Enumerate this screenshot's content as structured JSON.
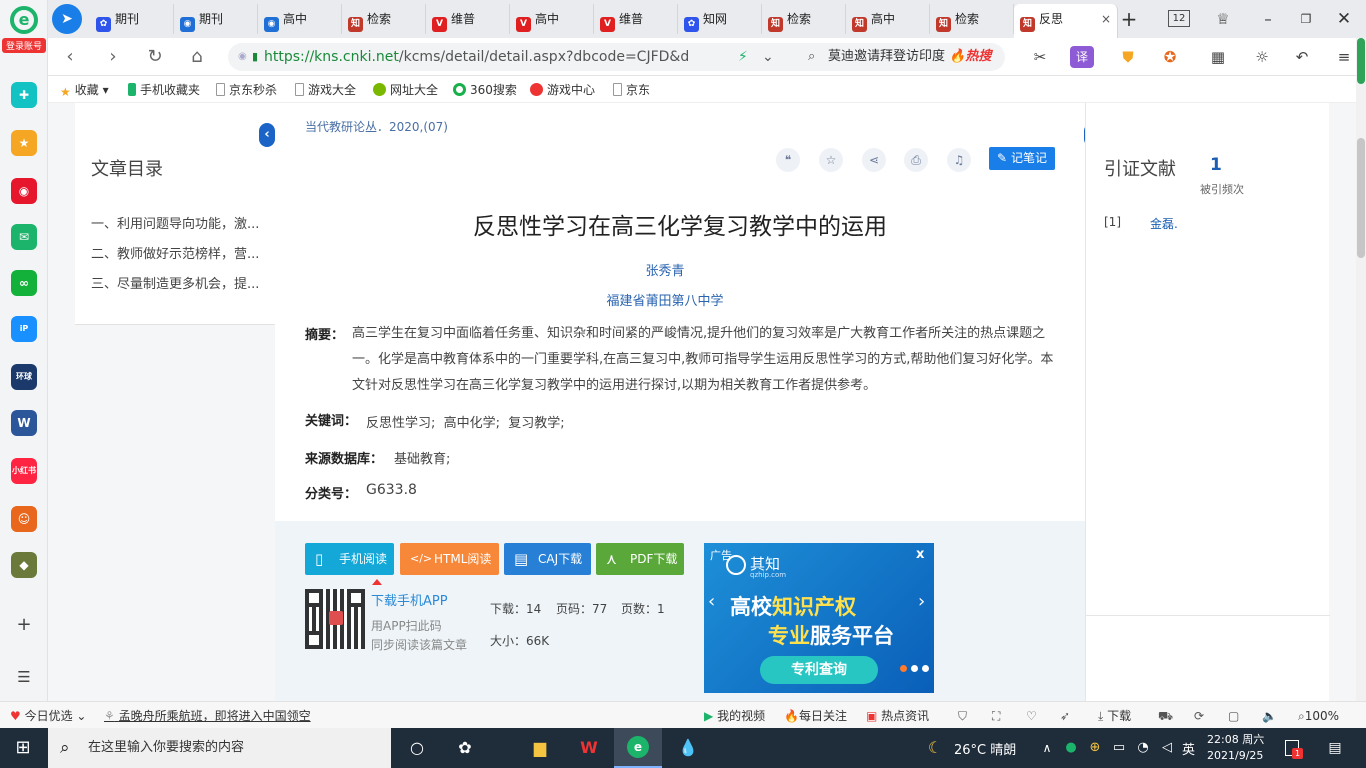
{
  "sidebar": {
    "login_label": "登录账号",
    "icons": [
      {
        "name": "plus-cross-app-icon",
        "glyph": "✚",
        "color": "#13c2c2"
      },
      {
        "name": "favorites-star-icon",
        "glyph": "★",
        "color": "#f5a623"
      },
      {
        "name": "weibo-icon",
        "glyph": "◉",
        "color": "#e6162d"
      },
      {
        "name": "mail-icon",
        "glyph": "✉",
        "color": "#1bb46a"
      },
      {
        "name": "link-app-icon",
        "glyph": "∞",
        "color": "#13b03a"
      },
      {
        "name": "ip-app-icon",
        "glyph": "iP",
        "color": "#1890ff"
      },
      {
        "name": "global-web-icon",
        "glyph": "环球",
        "color": "#1b3a6b"
      },
      {
        "name": "word-document-icon",
        "glyph": "W",
        "color": "#2b579a"
      },
      {
        "name": "xiaohongshu-icon",
        "glyph": "小红书",
        "color": "#ff2442"
      },
      {
        "name": "game-character-icon",
        "glyph": "☺",
        "color": "#e8671c"
      },
      {
        "name": "pubg-game-icon",
        "glyph": "◆",
        "color": "#6b7a3a"
      }
    ],
    "add_glyph": "+",
    "menu_glyph": "☰"
  },
  "tabs": [
    {
      "label": "期刊",
      "icon": "baidu-paw-icon",
      "glyph": "✿",
      "color": "#2f54eb"
    },
    {
      "label": "期刊",
      "icon": "chrome-circle-icon",
      "glyph": "◉",
      "color": "#1f6fd6"
    },
    {
      "label": "高中",
      "icon": "chrome-circle-icon",
      "glyph": "◉",
      "color": "#1f6fd6"
    },
    {
      "label": "检索",
      "icon": "cnki-zhi-icon",
      "glyph": "知",
      "color": "#c0392b"
    },
    {
      "label": "维普",
      "icon": "weipu-icon",
      "glyph": "V",
      "color": "#e02020"
    },
    {
      "label": "高中",
      "icon": "weipu-icon",
      "glyph": "V",
      "color": "#e02020"
    },
    {
      "label": "维普",
      "icon": "weipu-icon",
      "glyph": "V",
      "color": "#e02020"
    },
    {
      "label": "知网",
      "icon": "baidu-paw-icon",
      "glyph": "✿",
      "color": "#2f54eb"
    },
    {
      "label": "检索",
      "icon": "cnki-zhi-icon",
      "glyph": "知",
      "color": "#c0392b"
    },
    {
      "label": "高中",
      "icon": "cnki-zhi-icon",
      "glyph": "知",
      "color": "#c0392b"
    },
    {
      "label": "检索",
      "icon": "cnki-zhi-icon",
      "glyph": "知",
      "color": "#c0392b"
    },
    {
      "label": "反思",
      "icon": "cnki-zhi-icon",
      "glyph": "知",
      "color": "#c0392b",
      "active": true
    }
  ],
  "tabbar": {
    "new_tab": "+",
    "tab_count": "12",
    "close": "×"
  },
  "address": {
    "url_host": "https://kns.cnki.net",
    "url_path": "/kcms/detail/detail.aspx?dbcode=CJFD&d",
    "search_text": "莫迪邀请拜登访印度",
    "search_hot": "🔥热搜"
  },
  "bookmarks": [
    "收藏",
    "手机收藏夹",
    "京东秒杀",
    "游戏大全",
    "网址大全",
    "360搜索",
    "游戏中心",
    "京东"
  ],
  "article": {
    "source": "当代教研论丛．2020,(07)",
    "note_button": "记笔记",
    "title": "反思性学习在高三化学复习教学中的运用",
    "author": "张秀青",
    "institution": "福建省莆田第八中学",
    "abstract_label": "摘要：",
    "abstract": "高三学生在复习中面临着任务重、知识杂和时间紧的严峻情况,提升他们的复习效率是广大教育工作者所关注的热点课题之一。化学是高中教育体系中的一门重要学科,在高三复习中,教师可指导学生运用反思性学习的方式,帮助他们复习好化学。本文针对反思性学习在高三化学复习教学中的运用进行探讨,以期为相关教育工作者提供参考。",
    "keywords_label": "关键词：",
    "keywords": "反思性学习;  高中化学;  复习教学;",
    "db_label": "来源数据库：",
    "db": "基础教育;",
    "class_label": "分类号：",
    "class_no": "G633.8"
  },
  "toc": {
    "title": "文章目录",
    "items": [
      "一、利用问题导向功能，激...",
      "二、教师做好示范榜样，营...",
      "三、尽量制造更多机会，提..."
    ]
  },
  "citations": {
    "title": "引证文献",
    "count": "1",
    "count_label": "被引频次",
    "items": [
      {
        "index": "[1]",
        "author": "金磊."
      }
    ]
  },
  "download": {
    "buttons": [
      {
        "label": "手机阅读",
        "color": "#13a8d8",
        "name": "mobile-read-button",
        "glyph": "▯"
      },
      {
        "label": "HTML阅读",
        "color": "#f7883a",
        "name": "html-read-button",
        "glyph": "</>"
      },
      {
        "label": "CAJ下载",
        "color": "#2780d6",
        "name": "caj-download-button",
        "glyph": "▤"
      },
      {
        "label": "PDF下载",
        "color": "#5aa83a",
        "name": "pdf-download-button",
        "glyph": "⋏"
      }
    ],
    "app_link": "下载手机APP",
    "app_tip1": "用APP扫此码",
    "app_tip2": "同步阅读该篇文章",
    "downloads": "下载：14",
    "pages": "页码：77",
    "page_count": "页数：1",
    "size": "大小：66K"
  },
  "ad": {
    "tag": "广告",
    "brand": "其知",
    "brand_url": "qzhip.com",
    "line1a": "高校",
    "line1b": "知识产权",
    "line2a": "专业",
    "line2b": "服务平台",
    "cta": "专利查询",
    "close": "x"
  },
  "statusbar": {
    "left": "今日优选",
    "news": "孟晚舟所乘航班，即将进入中国领空",
    "video": "我的视频",
    "daily": "每日关注",
    "hotnews": "热点资讯",
    "download": "下载",
    "zoom": "100%"
  },
  "taskbar": {
    "search_placeholder": "在这里输入你要搜索的内容",
    "weather": "26°C 晴朗",
    "ime": "英",
    "time": "22:08 周六",
    "date": "2021/9/25",
    "notif": "1"
  }
}
